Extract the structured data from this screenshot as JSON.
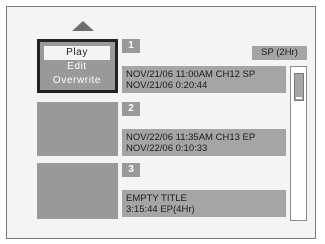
{
  "context_menu": {
    "items": [
      "Play",
      "Edit",
      "Overwrite"
    ],
    "selected_index": 0
  },
  "recording_mode": "SP (2Hr)",
  "titles": [
    {
      "number": "1",
      "line1": "NOV/21/06  11:00AM CH12  SP",
      "line2": "NOV/21/06    0:20:44"
    },
    {
      "number": "2",
      "line1": "NOV/22/06  11:35AM CH13  EP",
      "line2": "NOV/22/06    0:10:33"
    },
    {
      "number": "3",
      "line1": "EMPTY TITLE",
      "line2": "3:15:44  EP(4Hr)"
    }
  ],
  "colors": {
    "background": "#f4f4f4",
    "panel_gray": "#a5a5a5",
    "thumbnail_gray": "#999999",
    "selection_border": "#222222"
  },
  "icons": {
    "scroll_up": "triangle-up-icon"
  }
}
